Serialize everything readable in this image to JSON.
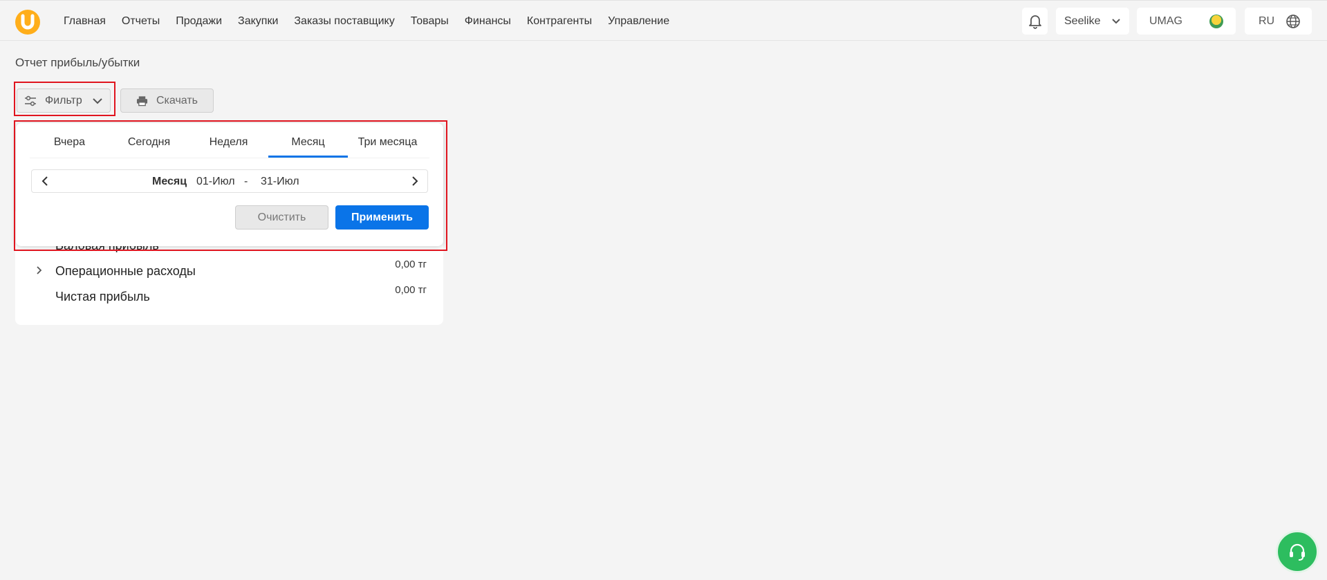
{
  "nav": {
    "items": [
      "Главная",
      "Отчеты",
      "Продажи",
      "Закупки",
      "Заказы поставщику",
      "Товары",
      "Финансы",
      "Контрагенты",
      "Управление"
    ]
  },
  "header": {
    "user": "Seelike",
    "store": "UMAG",
    "lang": "RU"
  },
  "page": {
    "title": "Отчет прибыль/убытки"
  },
  "toolbar": {
    "filter_label": "Фильтр",
    "download_label": "Скачать"
  },
  "filter_popup": {
    "tabs": [
      "Вчера",
      "Сегодня",
      "Неделя",
      "Месяц",
      "Три месяца"
    ],
    "active_tab": "Месяц",
    "range": {
      "period_label": "Месяц",
      "from": "01-Июл",
      "separator": "-",
      "to": "31-Июл"
    },
    "clear_label": "Очистить",
    "apply_label": "Применить"
  },
  "report": {
    "rows": [
      {
        "label": "Валовая прибыль",
        "value": ""
      },
      {
        "label": "Операционные расходы",
        "value": "0,00 тг"
      },
      {
        "label": "Чистая прибыль",
        "value": "0,00 тг"
      }
    ]
  },
  "colors": {
    "accent": "#0a74e8",
    "logo": "#ffae1a",
    "highlight": "#e0141e",
    "help": "#2dbd5f"
  }
}
